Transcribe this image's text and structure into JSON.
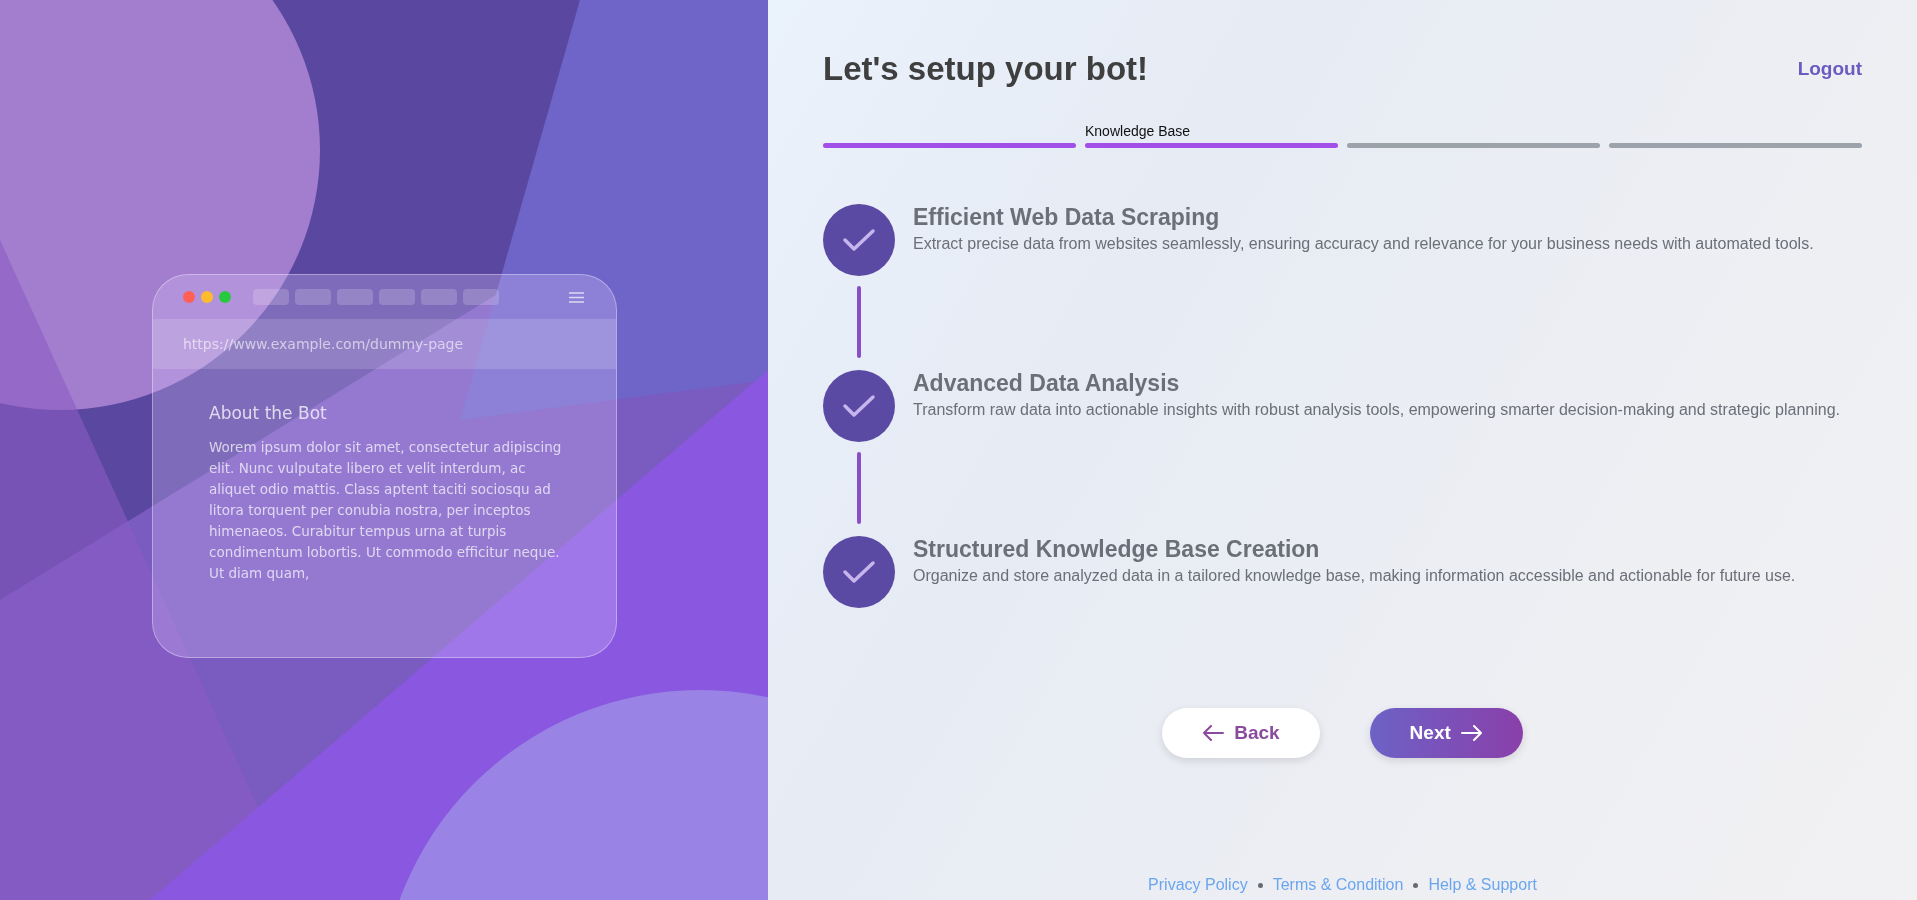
{
  "preview": {
    "url": "https://www.example.com/dummy-page",
    "heading": "About the Bot",
    "body": "Worem ipsum dolor sit amet, consectetur adipiscing elit. Nunc vulputate libero et velit interdum, ac aliquet odio mattis. Class aptent taciti sociosqu ad litora torquent per conubia nostra, per inceptos himenaeos. Curabitur tempus urna at turpis condimentum lobortis. Ut commodo efficitur neque. Ut diam quam,"
  },
  "header": {
    "title": "Let's setup your bot!",
    "logout": "Logout"
  },
  "progress": [
    {
      "filled": true
    },
    {
      "filled": true,
      "label": "Knowledge Base"
    },
    {
      "filled": false
    },
    {
      "filled": false
    }
  ],
  "features": [
    {
      "title": "Efficient Web Data Scraping",
      "text": "Extract precise data from websites seamlessly, ensuring accuracy and relevance for your business needs with automated tools.",
      "done": true
    },
    {
      "title": "Advanced Data Analysis",
      "text": "Transform raw data into actionable insights with robust analysis tools, empowering smarter decision-making and strategic planning.",
      "done": true
    },
    {
      "title": "Structured Knowledge Base Creation",
      "text": "Organize and store analyzed data in a tailored knowledge base, making information accessible and actionable for future use.",
      "done": true
    }
  ],
  "buttons": {
    "back": "Back",
    "next": "Next"
  },
  "footer": [
    "Privacy Policy",
    "Terms & Condition",
    "Help & Support"
  ]
}
